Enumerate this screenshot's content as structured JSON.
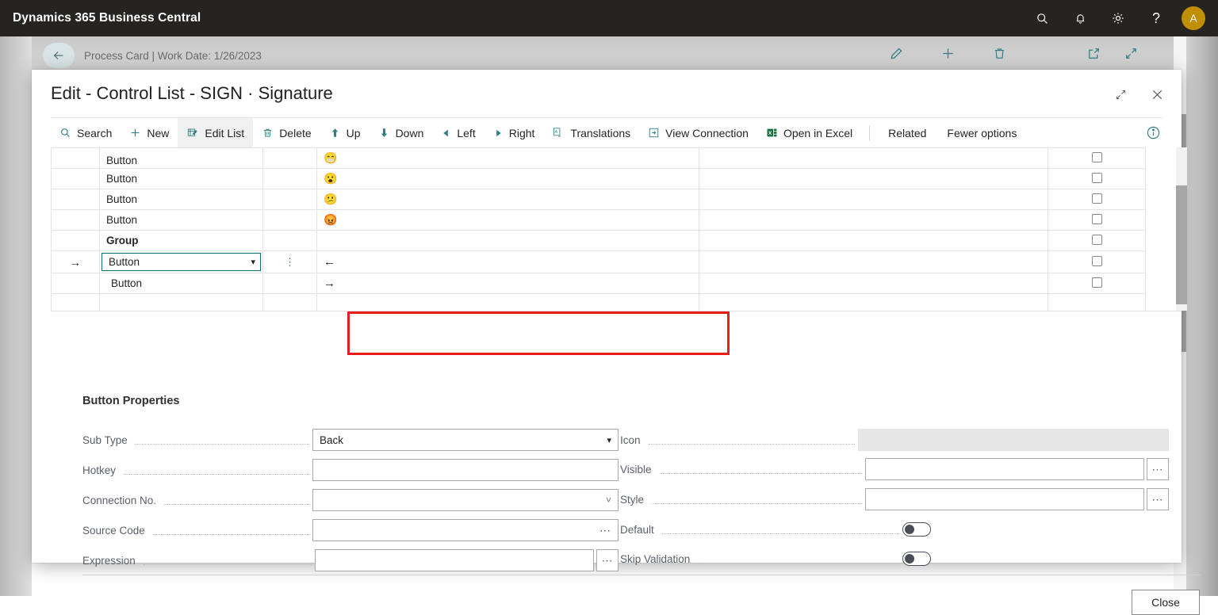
{
  "appbar": {
    "title": "Dynamics 365 Business Central",
    "icons": [
      "search-icon",
      "bell-icon",
      "gear-icon",
      "help-icon"
    ],
    "avatar_initial": "A",
    "avatar_color": "#bf8f00"
  },
  "background_page": {
    "breadcrumb": "Process Card | Work Date: 1/26/2023",
    "actions": [
      "edit-pencil-icon",
      "add-plus-icon",
      "delete-trash-icon"
    ],
    "window_actions": [
      "open-new-window-icon",
      "shrink-icon"
    ]
  },
  "dialog": {
    "title": "Edit - Control List - SIGN · Signature",
    "window_buttons": [
      "shrink-icon",
      "close-icon"
    ],
    "toolbar": {
      "items": [
        {
          "label": "Search",
          "icon": "search-icon",
          "active": false
        },
        {
          "label": "New",
          "icon": "plus-icon",
          "active": false
        },
        {
          "label": "Edit List",
          "icon": "edit-list-icon",
          "active": true
        },
        {
          "label": "Delete",
          "icon": "trash-icon",
          "active": false
        },
        {
          "label": "Up",
          "icon": "arrow-up-icon",
          "active": false
        },
        {
          "label": "Down",
          "icon": "arrow-down-icon",
          "active": false
        },
        {
          "label": "Left",
          "icon": "arrow-left-icon",
          "active": false
        },
        {
          "label": "Right",
          "icon": "arrow-right-icon",
          "active": false
        },
        {
          "label": "Translations",
          "icon": "translations-icon",
          "active": false
        },
        {
          "label": "View Connection",
          "icon": "view-connection-icon",
          "active": false
        },
        {
          "label": "Open in Excel",
          "icon": "excel-icon",
          "active": false
        }
      ],
      "menus": [
        "Related",
        "Fewer options"
      ],
      "info_icon": "info-icon"
    },
    "grid": {
      "rows": [
        {
          "name": "Button",
          "emoji": "😁",
          "emoji_name": "grinning-face-emoji",
          "checkbox": false,
          "bold": false,
          "selected": false,
          "partial": true
        },
        {
          "name": "Button",
          "emoji": "😮",
          "emoji_name": "astonished-face-emoji",
          "checkbox": false,
          "bold": false,
          "selected": false
        },
        {
          "name": "Button",
          "emoji": "😕",
          "emoji_name": "confused-face-emoji",
          "checkbox": false,
          "bold": false,
          "selected": false
        },
        {
          "name": "Button",
          "emoji": "😡",
          "emoji_name": "angry-face-emoji",
          "checkbox": false,
          "bold": false,
          "selected": false
        },
        {
          "name": "Group",
          "emoji": "",
          "emoji_name": "",
          "checkbox": false,
          "bold": true,
          "selected": false
        },
        {
          "name": "Button",
          "emoji": "←",
          "emoji_name": "arrow-left-icon",
          "checkbox": false,
          "bold": false,
          "selected": true
        },
        {
          "name": "Button",
          "emoji": "→",
          "emoji_name": "arrow-right-icon",
          "checkbox": false,
          "bold": false,
          "selected": false
        },
        {
          "name": "",
          "emoji": "",
          "emoji_name": "",
          "checkbox": false,
          "bold": false,
          "selected": false
        }
      ],
      "selected_row_value": "Button",
      "row_indicator": "→",
      "highlight_border_color": "#ea1c1c",
      "selection_fill_color": "#c7e8ea",
      "selection_border_color": "#0f6c72"
    },
    "properties": {
      "heading": "Button Properties",
      "left_fields": [
        {
          "label": "Sub Type",
          "value": "Back",
          "placeholder": "",
          "control": "dropdown"
        },
        {
          "label": "Hotkey",
          "value": "",
          "placeholder": "",
          "control": "text"
        },
        {
          "label": "Connection No.",
          "value": "",
          "placeholder": "",
          "control": "lookup-thin"
        },
        {
          "label": "Source Code",
          "value": "",
          "placeholder": "",
          "control": "ellipsis-inside"
        },
        {
          "label": "Expression",
          "value": "",
          "placeholder": "",
          "control": "ellipsis-outside"
        }
      ],
      "right_fields": [
        {
          "label": "Icon",
          "value": "",
          "placeholder": "",
          "control": "readonly"
        },
        {
          "label": "Visible",
          "value": "",
          "placeholder": "",
          "control": "ellipsis-outside"
        },
        {
          "label": "Style",
          "value": "",
          "placeholder": "",
          "control": "ellipsis-outside"
        },
        {
          "label": "Default",
          "value": "off",
          "placeholder": "",
          "control": "toggle"
        },
        {
          "label": "Skip Validation",
          "value": "off",
          "placeholder": "",
          "control": "toggle"
        }
      ]
    },
    "close_button": "Close"
  }
}
